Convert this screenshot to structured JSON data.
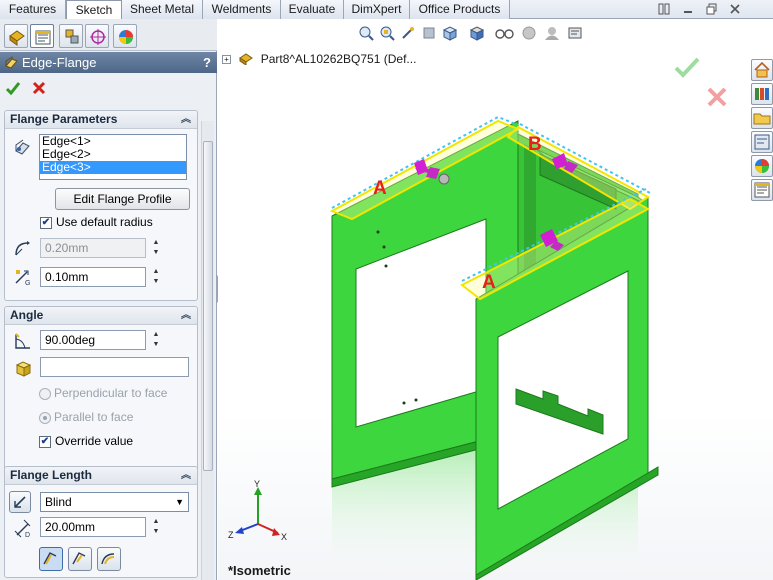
{
  "tabs": [
    {
      "label": "Features",
      "active": false
    },
    {
      "label": "Sketch",
      "active": true
    },
    {
      "label": "Sheet Metal",
      "active": false
    },
    {
      "label": "Weldments",
      "active": false
    },
    {
      "label": "Evaluate",
      "active": false
    },
    {
      "label": "DimXpert",
      "active": false
    },
    {
      "label": "Office Products",
      "active": false
    }
  ],
  "property_manager": {
    "title": "Edge-Flange",
    "help": "?",
    "flange_parameters": {
      "header": "Flange Parameters",
      "edges": [
        "Edge<1>",
        "Edge<2>",
        "Edge<3>"
      ],
      "selected_edge_index": 2,
      "edit_profile_button": "Edit Flange Profile",
      "use_default_radius_label": "Use default radius",
      "use_default_radius_checked": true,
      "radius_value": "0.20mm",
      "gap_value": "0.10mm"
    },
    "angle": {
      "header": "Angle",
      "angle_value": "90.00deg",
      "face_value": "",
      "perpendicular_label": "Perpendicular to face",
      "parallel_label": "Parallel to face",
      "override_label": "Override value",
      "override_checked": true
    },
    "flange_length": {
      "header": "Flange Length",
      "end_condition": "Blind",
      "length_value": "20.00mm"
    }
  },
  "viewport": {
    "feature_tree_root": "Part8^AL10262BQ751  (Def...",
    "view_orientation": "*Isometric",
    "callouts": [
      "A",
      "B",
      "A"
    ],
    "triad_axes": [
      "Y",
      "X",
      "Z"
    ]
  },
  "colors": {
    "model_green": "#3ed63e",
    "model_edge": "#1c7a1c",
    "flange_highlight": "#ffff66",
    "callout_red": "#e8201c",
    "handle_magenta": "#d21fd2",
    "title_bar": "#5a7293"
  }
}
